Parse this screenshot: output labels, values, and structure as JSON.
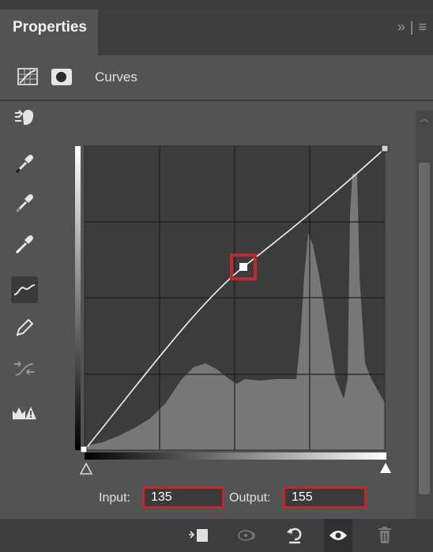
{
  "panel": {
    "tab_title": "Properties",
    "tab_controls": [
      "»",
      "|",
      "≡"
    ],
    "adjustment_name": "Curves"
  },
  "toolbar": {
    "tools": [
      {
        "name": "on-image-adjust",
        "icon": "hand-adjust-icon"
      },
      {
        "name": "sample-black",
        "icon": "eyedropper-black-icon"
      },
      {
        "name": "sample-gray",
        "icon": "eyedropper-gray-icon"
      },
      {
        "name": "sample-white",
        "icon": "eyedropper-white-icon"
      },
      {
        "name": "edit-points",
        "icon": "curve-icon",
        "selected": true
      },
      {
        "name": "draw-curve",
        "icon": "pencil-icon"
      },
      {
        "name": "smooth",
        "icon": "smooth-curve-icon"
      },
      {
        "name": "clipping",
        "icon": "clipping-warning-icon"
      }
    ]
  },
  "curve": {
    "points": [
      [
        0,
        0
      ],
      [
        135,
        155
      ],
      [
        255,
        255
      ]
    ],
    "selected_point": [
      135,
      155
    ],
    "grid": true
  },
  "io": {
    "input_label": "Input:",
    "input_value": "135",
    "output_label": "Output:",
    "output_value": "155"
  },
  "colors": {
    "highlight": "#c0282d",
    "panel_bg": "#535353",
    "graph_bg": "#3c3c3c",
    "histogram": "#777777"
  },
  "bottom_bar": {
    "icons": [
      "clip-to-layer-icon",
      "view-previous-icon",
      "reset-icon",
      "visibility-eye-icon",
      "trash-icon"
    ]
  }
}
